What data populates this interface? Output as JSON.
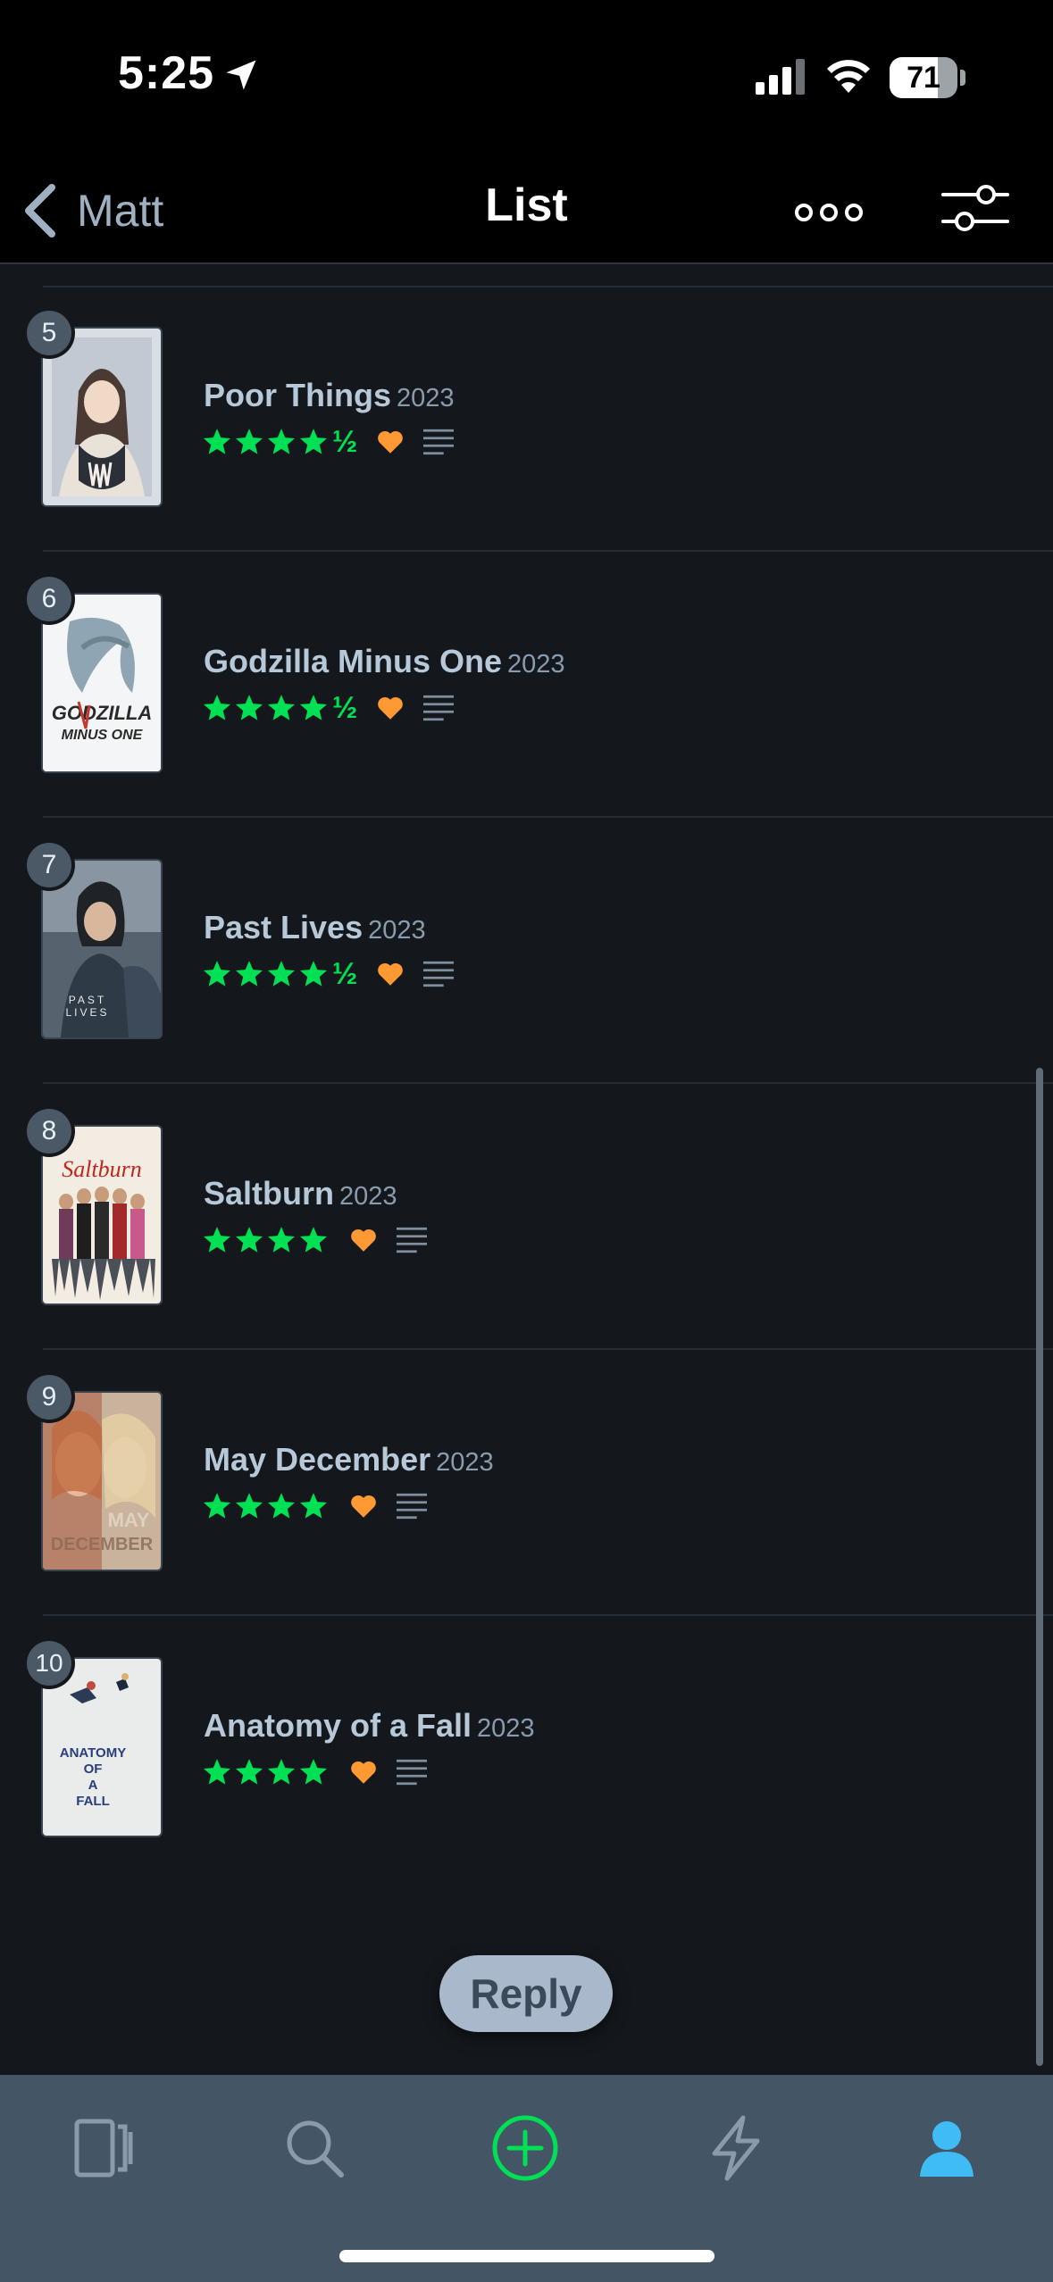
{
  "status_bar": {
    "time": "5:25",
    "battery": "71",
    "battery_level": 0.71
  },
  "nav": {
    "back_label": "Matt",
    "title": "List"
  },
  "colors": {
    "star": "#00e054",
    "heart": "#ff9933",
    "accent_blue": "#40bcf4",
    "tab_add": "#00e054"
  },
  "films": [
    {
      "rank": "5",
      "title": "Poor Things",
      "year": "2023",
      "rating": 4.5,
      "liked": true,
      "has_review": true
    },
    {
      "rank": "6",
      "title": "Godzilla Minus One",
      "year": "2023",
      "rating": 4.5,
      "liked": true,
      "has_review": true
    },
    {
      "rank": "7",
      "title": "Past Lives",
      "year": "2023",
      "rating": 4.5,
      "liked": true,
      "has_review": true
    },
    {
      "rank": "8",
      "title": "Saltburn",
      "year": "2023",
      "rating": 4,
      "liked": true,
      "has_review": true
    },
    {
      "rank": "9",
      "title": "May December",
      "year": "2023",
      "rating": 4,
      "liked": true,
      "has_review": true
    },
    {
      "rank": "10",
      "title": "Anatomy of a Fall",
      "year": "2023",
      "rating": 4,
      "liked": true,
      "has_review": true
    }
  ],
  "posters": {
    "poor_things": "",
    "godzilla": "GODZILLA MINUS ONE",
    "past_lives": "PAST LIVES",
    "saltburn": "Saltburn",
    "may_december": "MAY DECEMBER",
    "anatomy": "ANATOMY OF A FALL"
  },
  "reply_label": "Reply",
  "half_star_glyph": "½",
  "tabs": [
    "films-tab",
    "search-tab",
    "add-tab",
    "activity-tab",
    "profile-tab"
  ]
}
